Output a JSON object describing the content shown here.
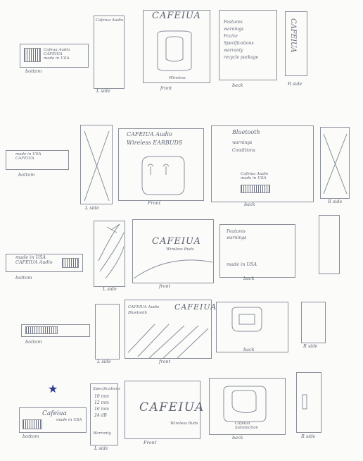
{
  "rows": [
    {
      "left_side_text": "Cafeiua Audio",
      "bottom_label": "bottom",
      "bottom_text": "Cafeua Audio\nCAFEIUA\nmade in USA",
      "side_label": "L side",
      "front_brand": "CAFEIUA",
      "front_label": "front",
      "front_model": "Wireless",
      "back_items": [
        "Features",
        "warnings",
        "Fcc/ce",
        "Specifications",
        "warranty",
        "recycle package"
      ],
      "back_label": "back",
      "rside_text": "CAFEIUA",
      "rside_label": "R side"
    },
    {
      "bottom_label": "bottom",
      "bottom_text": "made in USA\nCAFEIUA",
      "side_label": "L side",
      "front_title": "CAFEIUA Audio",
      "front_subtitle": "Wireless EARBUDS",
      "front_label": "Front",
      "back_title": "Bluetooth",
      "back_items": [
        "warnings",
        "Conditions"
      ],
      "back_mini": "Cafeiua Audio\nmade in USA",
      "back_label": "back",
      "rside_label": "R side"
    },
    {
      "bottom_label": "bottom",
      "bottom_text": "made in USA\nCAFEIUA Audio",
      "side_label": "L side",
      "front_brand": "CAFEIUA",
      "front_sub": "Wireless Buds",
      "front_label": "front",
      "back_items": [
        "Features",
        "warnings"
      ],
      "back_made": "made in USA",
      "back_label": "back"
    },
    {
      "bottom_label": "bottom",
      "side_label": "L side",
      "front_left": "CAFEIUA Audio",
      "front_left2": "Bluetooth",
      "front_brand": "CAFEIUA",
      "front_label": "front",
      "back_label": "back",
      "rside_label": "R side"
    },
    {
      "star": "★",
      "bottom_text": "Cafeiua",
      "bottom_sub": "made in USA",
      "bottom_label": "bottom",
      "side_title": "Specifications",
      "side_items": [
        "10 mm",
        "12 mm",
        "16 mm",
        "24 dB"
      ],
      "side_footer": "Warranty",
      "side_label": "L side",
      "front_brand": "CAFEIUA",
      "front_sub": "Wireless Buds",
      "front_label": "Front",
      "back_text": "Cafeiua\nSatisfaction",
      "back_label": "back",
      "rside_label": "R side"
    }
  ]
}
